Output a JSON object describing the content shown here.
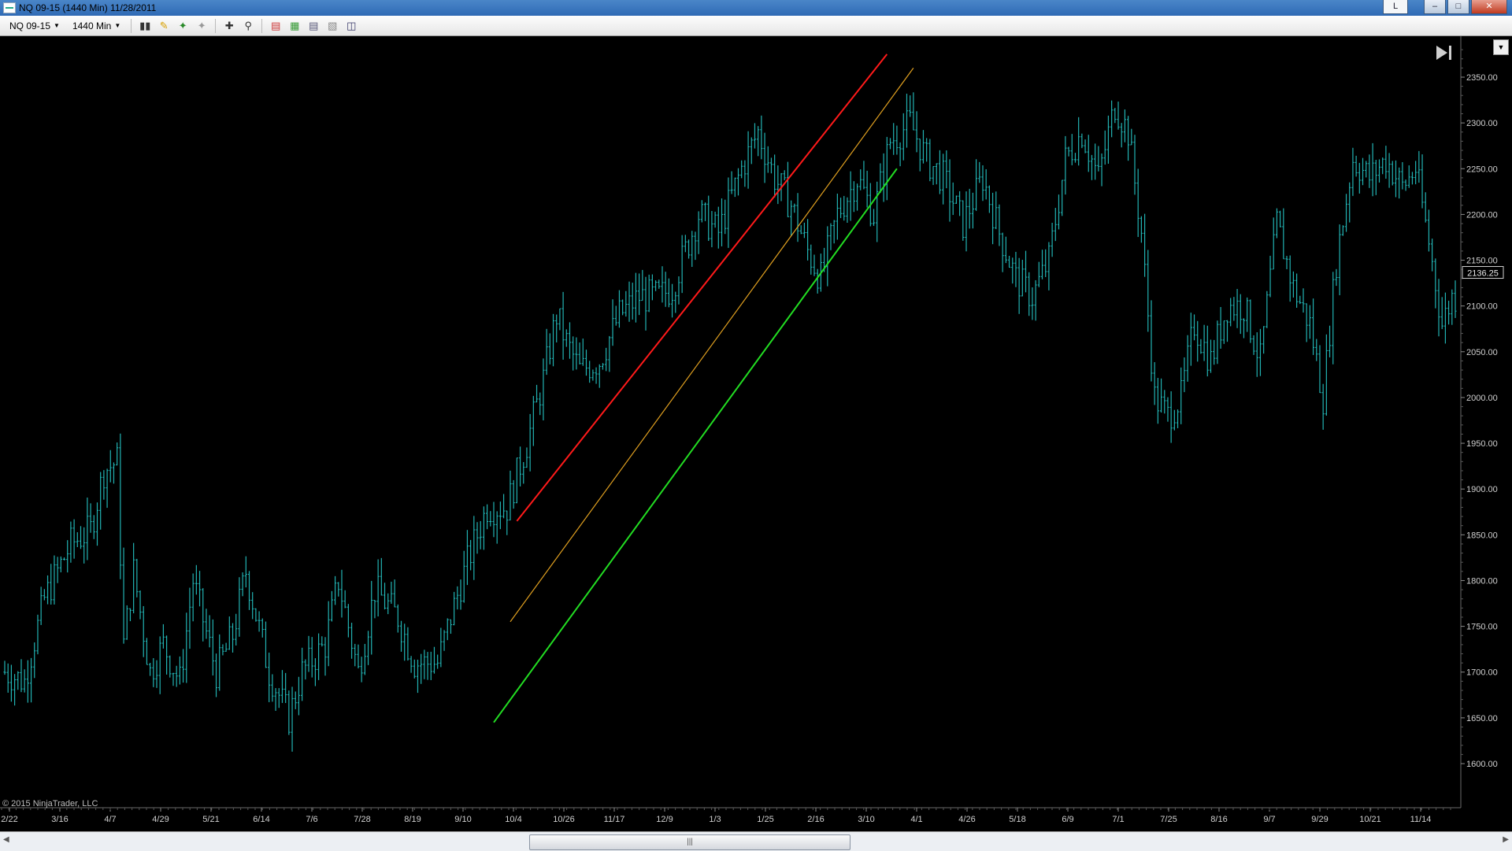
{
  "window": {
    "title": "NQ 09-15 (1440 Min)  11/28/2011",
    "link_label": "L"
  },
  "toolbar": {
    "instrument": "NQ 09-15",
    "period": "1440 Min",
    "icons": [
      "bar-style-icon",
      "draw-pencil-icon",
      "indicator-add-icon",
      "strategy-icon",
      "crosshair-icon",
      "zoom-icon",
      "chart-trader-icon",
      "data-box-icon",
      "properties-icon",
      "template-icon",
      "window-icon"
    ]
  },
  "copyright": "© 2015 NinjaTrader, LLC",
  "last_price_label": "2136.25",
  "colors": {
    "background": "#000000",
    "bars": "#22b3b3",
    "channel_top": "#ff1a1a",
    "channel_mid": "#e0a020",
    "channel_bottom": "#22dd22",
    "axis_text": "#cfcfcf"
  },
  "chart_data": {
    "type": "ohlc",
    "title": "",
    "xlabel": "",
    "ylabel": "",
    "ylim": [
      1570,
      2380
    ],
    "y_ticks": [
      1600,
      1650,
      1700,
      1750,
      1800,
      1850,
      1900,
      1950,
      2000,
      2050,
      2100,
      2150,
      2200,
      2250,
      2300,
      2350
    ],
    "y_tick_labels": [
      "1600.00",
      "1650.00",
      "1700.00",
      "1750.00",
      "1800.00",
      "1850.00",
      "1900.00",
      "1950.00",
      "2000.00",
      "2050.00",
      "2100.00",
      "2150.00",
      "2200.00",
      "2250.00",
      "2300.00",
      "2350.00"
    ],
    "x_tick_labels": [
      "2/22",
      "3/16",
      "4/7",
      "4/29",
      "5/21",
      "6/14",
      "7/6",
      "7/28",
      "8/19",
      "9/10",
      "10/4",
      "10/26",
      "11/17",
      "12/9",
      "1/3",
      "1/25",
      "2/16",
      "3/10",
      "4/1",
      "4/26",
      "5/18",
      "6/9",
      "7/1",
      "7/25",
      "8/16",
      "9/7",
      "9/29",
      "10/21",
      "11/14"
    ],
    "bar_count": 292,
    "close_path": [
      {
        "bar": 0,
        "price": 1700
      },
      {
        "bar": 6,
        "price": 1690
      },
      {
        "bar": 12,
        "price": 1780
      },
      {
        "bar": 20,
        "price": 1840
      },
      {
        "bar": 26,
        "price": 1855
      },
      {
        "bar": 30,
        "price": 1920
      },
      {
        "bar": 34,
        "price": 1930
      },
      {
        "bar": 36,
        "price": 1730
      },
      {
        "bar": 39,
        "price": 1810
      },
      {
        "bar": 44,
        "price": 1700
      },
      {
        "bar": 48,
        "price": 1730
      },
      {
        "bar": 53,
        "price": 1690
      },
      {
        "bar": 57,
        "price": 1800
      },
      {
        "bar": 64,
        "price": 1700
      },
      {
        "bar": 69,
        "price": 1740
      },
      {
        "bar": 73,
        "price": 1810
      },
      {
        "bar": 80,
        "price": 1700
      },
      {
        "bar": 86,
        "price": 1650
      },
      {
        "bar": 90,
        "price": 1700
      },
      {
        "bar": 97,
        "price": 1730
      },
      {
        "bar": 101,
        "price": 1800
      },
      {
        "bar": 107,
        "price": 1700
      },
      {
        "bar": 112,
        "price": 1790
      },
      {
        "bar": 119,
        "price": 1760
      },
      {
        "bar": 124,
        "price": 1710
      },
      {
        "bar": 131,
        "price": 1710
      },
      {
        "bar": 135,
        "price": 1760
      },
      {
        "bar": 140,
        "price": 1820
      },
      {
        "bar": 146,
        "price": 1880
      },
      {
        "bar": 152,
        "price": 1880
      },
      {
        "bar": 158,
        "price": 1950
      },
      {
        "bar": 163,
        "price": 2020
      },
      {
        "bar": 167,
        "price": 2090
      },
      {
        "bar": 170,
        "price": 2060
      },
      {
        "bar": 174,
        "price": 2030
      },
      {
        "bar": 180,
        "price": 2040
      },
      {
        "bar": 186,
        "price": 2090
      },
      {
        "bar": 192,
        "price": 2110
      },
      {
        "bar": 198,
        "price": 2110
      },
      {
        "bar": 202,
        "price": 2120
      },
      {
        "bar": 210,
        "price": 2200
      },
      {
        "bar": 216,
        "price": 2180
      },
      {
        "bar": 223,
        "price": 2250
      },
      {
        "bar": 228,
        "price": 2290
      },
      {
        "bar": 233,
        "price": 2240
      },
      {
        "bar": 238,
        "price": 2210
      },
      {
        "bar": 243,
        "price": 2160
      },
      {
        "bar": 247,
        "price": 2130
      },
      {
        "bar": 252,
        "price": 2200
      },
      {
        "bar": 258,
        "price": 2240
      },
      {
        "bar": 263,
        "price": 2200
      },
      {
        "bar": 268,
        "price": 2280
      },
      {
        "bar": 274,
        "price": 2300
      },
      {
        "bar": 279,
        "price": 2260
      },
      {
        "bar": 284,
        "price": 2240
      },
      {
        "bar": 290,
        "price": 2190
      },
      {
        "bar": 296,
        "price": 2240
      },
      {
        "bar": 301,
        "price": 2180
      },
      {
        "bar": 306,
        "price": 2130
      },
      {
        "bar": 311,
        "price": 2110
      },
      {
        "bar": 316,
        "price": 2150
      },
      {
        "bar": 321,
        "price": 2260
      },
      {
        "bar": 326,
        "price": 2290
      },
      {
        "bar": 331,
        "price": 2240
      },
      {
        "bar": 336,
        "price": 2320
      },
      {
        "bar": 340,
        "price": 2290
      },
      {
        "bar": 344,
        "price": 2180
      },
      {
        "bar": 348,
        "price": 2000
      },
      {
        "bar": 352,
        "price": 1980
      },
      {
        "bar": 356,
        "price": 2000
      },
      {
        "bar": 360,
        "price": 2080
      },
      {
        "bar": 365,
        "price": 2040
      },
      {
        "bar": 370,
        "price": 2100
      },
      {
        "bar": 375,
        "price": 2100
      },
      {
        "bar": 380,
        "price": 2040
      },
      {
        "bar": 385,
        "price": 2190
      },
      {
        "bar": 390,
        "price": 2120
      },
      {
        "bar": 395,
        "price": 2080
      },
      {
        "bar": 399,
        "price": 2000
      },
      {
        "bar": 403,
        "price": 2150
      },
      {
        "bar": 408,
        "price": 2260
      },
      {
        "bar": 413,
        "price": 2240
      },
      {
        "bar": 418,
        "price": 2260
      },
      {
        "bar": 423,
        "price": 2230
      },
      {
        "bar": 427,
        "price": 2250
      },
      {
        "bar": 431,
        "price": 2170
      },
      {
        "bar": 435,
        "price": 2080
      },
      {
        "bar": 438,
        "price": 2110
      }
    ],
    "channel_lines": [
      {
        "name": "",
        "color": "#ff1a1a",
        "from": {
          "bar": 155,
          "price": 1865
        },
        "to": {
          "bar": 267,
          "price": 2375
        }
      },
      {
        "name": "",
        "color": "#e0a020",
        "from": {
          "bar": 153,
          "price": 1755
        },
        "to": {
          "bar": 275,
          "price": 2360
        }
      },
      {
        "name": "",
        "color": "#22dd22",
        "from": {
          "bar": 148,
          "price": 1645
        },
        "to": {
          "bar": 270,
          "price": 2250
        }
      }
    ]
  }
}
